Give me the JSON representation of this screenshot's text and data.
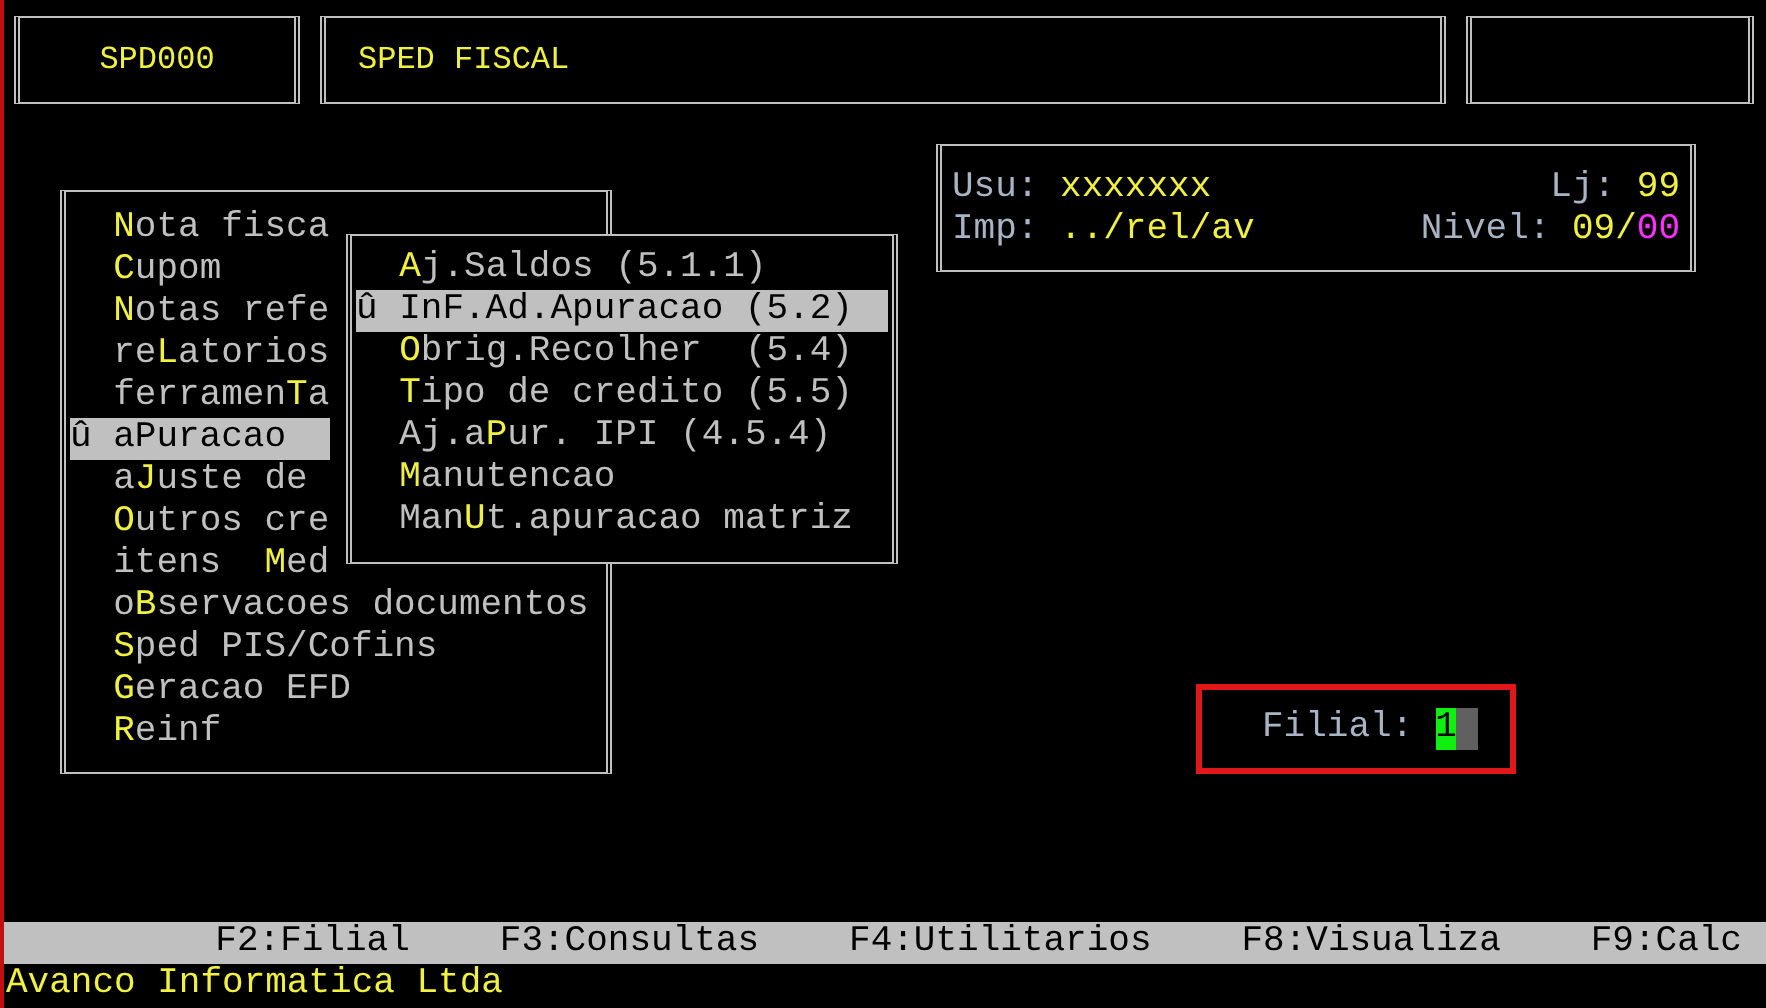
{
  "header": {
    "program_code": "SPD000",
    "title": "SPED FISCAL"
  },
  "main_menu": {
    "marker": "û",
    "items": [
      {
        "label": "**N**ota fisca",
        "selected": false
      },
      {
        "label": "**C**upom",
        "selected": false
      },
      {
        "label": "**N**otas refe",
        "selected": false
      },
      {
        "label": "re**L**atorios",
        "selected": false
      },
      {
        "label": "ferramen**T**a",
        "selected": false
      },
      {
        "label": "aPuracao",
        "selected": true
      },
      {
        "label": "a**J**uste de",
        "selected": false
      },
      {
        "label": "**O**utros cre",
        "selected": false
      },
      {
        "label": "itens  **M**ed",
        "selected": false
      },
      {
        "label": "o**B**servacoes documentos",
        "selected": false
      },
      {
        "label": "**S**ped PIS/Cofins",
        "selected": false
      },
      {
        "label": "**G**eracao EFD",
        "selected": false
      },
      {
        "label": "**R**einf",
        "selected": false
      }
    ]
  },
  "submenu": {
    "marker": "û",
    "items": [
      {
        "label": "**A**j.Saldos (5.1.1)",
        "selected": false
      },
      {
        "label": "InF.Ad.Apuracao (5.2)",
        "selected": true
      },
      {
        "label": "**O**brig.Recolher  (5.4)",
        "selected": false
      },
      {
        "label": "**T**ipo de credito (5.5)",
        "selected": false
      },
      {
        "label": "Aj.a**P**ur. IPI (4.5.4)",
        "selected": false
      },
      {
        "label": "**M**anutencao",
        "selected": false
      },
      {
        "label": "Man**U**t.apuracao matriz",
        "selected": false
      }
    ]
  },
  "session": {
    "user_label": "Usu:",
    "user": "xxxxxxx",
    "store_label": "Lj:",
    "store": "99",
    "printer_label": "Imp:",
    "printer": "../rel/av",
    "access_label": "Nivel:",
    "access_level": "09/*00*"
  },
  "filial": {
    "label": "Filial:",
    "value": "1"
  },
  "function_keys": [
    "F2:Filial",
    "F3:Consultas",
    "F4:Utilitarios",
    "F8:Visualiza",
    "F9:Calc"
  ],
  "footer": "Avanco Informatica Ltda"
}
